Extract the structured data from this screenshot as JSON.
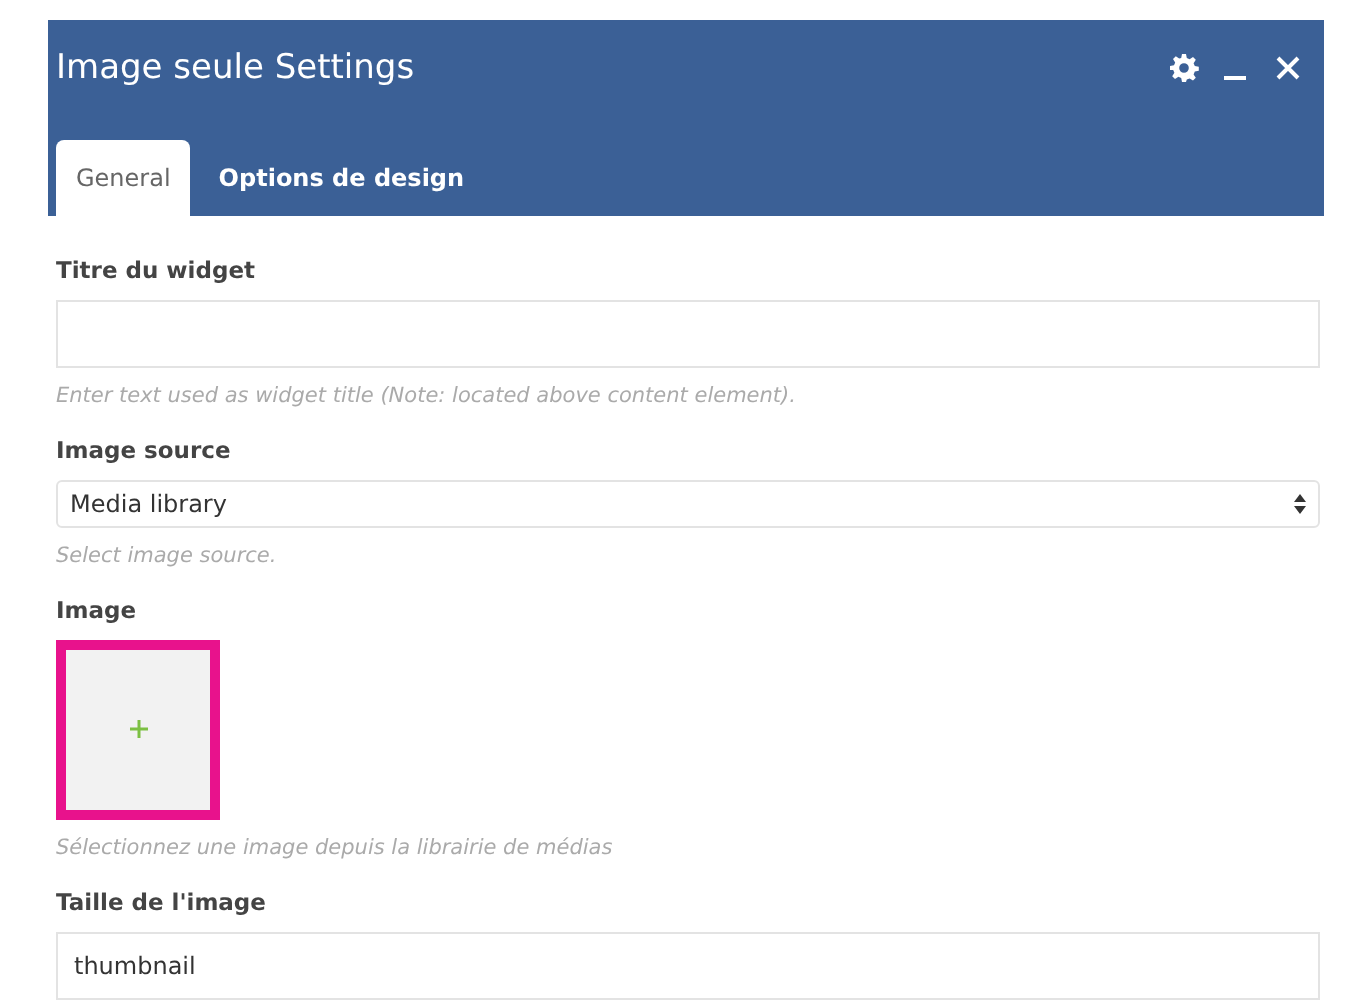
{
  "window": {
    "title": "Image seule Settings"
  },
  "tabs": [
    {
      "label": "General",
      "selected": true
    },
    {
      "label": "Options de design",
      "selected": false
    }
  ],
  "fields": [
    {
      "kind": "text",
      "label": "Titre du widget",
      "hint": "Enter text used as widget title (Note: located above content element)."
    },
    {
      "kind": "select",
      "label": "Image source",
      "value": "Media library",
      "hint": "Select image source."
    },
    {
      "kind": "image",
      "label": "Image",
      "highlighted": true,
      "hint": "Sélectionnez une image depuis la librairie de médias"
    },
    {
      "kind": "text",
      "label": "Taille de l'image",
      "value": "thumbnail"
    }
  ]
}
